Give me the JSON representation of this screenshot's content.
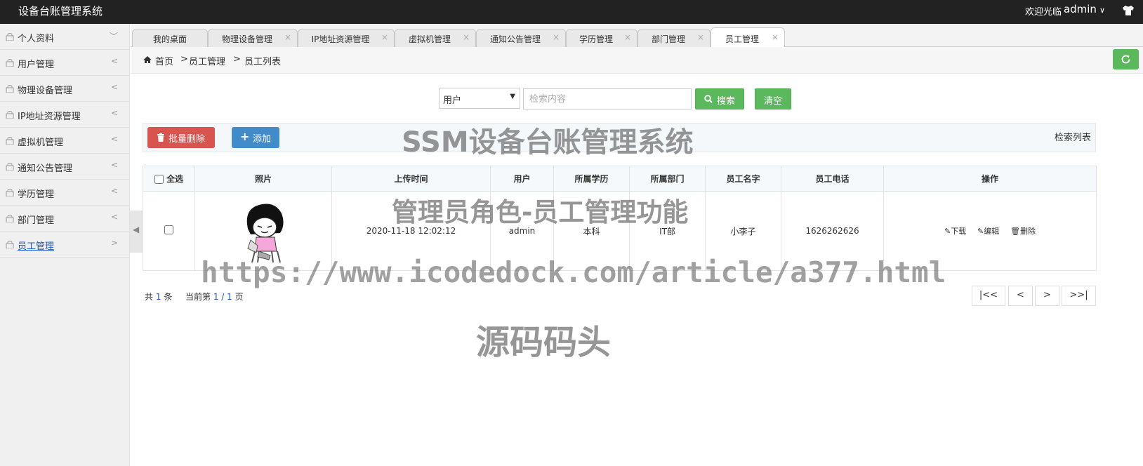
{
  "app": {
    "title": "设备台账管理系统",
    "welcome": "欢迎光临",
    "username": "admin"
  },
  "sidebar": {
    "items": [
      {
        "label": "个人资料",
        "arrow": "﹀"
      },
      {
        "label": "用户管理",
        "arrow": "<"
      },
      {
        "label": "物理设备管理",
        "arrow": "<"
      },
      {
        "label": "IP地址资源管理",
        "arrow": "<"
      },
      {
        "label": "虚拟机管理",
        "arrow": "<"
      },
      {
        "label": "通知公告管理",
        "arrow": "<"
      },
      {
        "label": "学历管理",
        "arrow": "<"
      },
      {
        "label": "部门管理",
        "arrow": "<"
      },
      {
        "label": "员工管理",
        "arrow": ">"
      }
    ]
  },
  "tabs": [
    {
      "label": "我的桌面"
    },
    {
      "label": "物理设备管理"
    },
    {
      "label": "IP地址资源管理"
    },
    {
      "label": "虚拟机管理"
    },
    {
      "label": "通知公告管理"
    },
    {
      "label": "学历管理"
    },
    {
      "label": "部门管理"
    },
    {
      "label": "员工管理"
    }
  ],
  "tab_close": "×",
  "breadcrumb": {
    "home": "首页",
    "level1": "员工管理",
    "level2": "员工列表",
    "sep": ">"
  },
  "search": {
    "field_selected": "用户",
    "placeholder": "检索内容",
    "value": "",
    "search_label": "搜索",
    "clear_label": "清空"
  },
  "toolbar": {
    "batch_delete_label": "批量删除",
    "add_label": "添加",
    "list_title": "检索列表"
  },
  "table": {
    "headers": {
      "select_all": "全选",
      "photo": "照片",
      "upload_time": "上传时间",
      "user": "用户",
      "education": "所属学历",
      "department": "所属部门",
      "name": "员工名字",
      "phone": "员工电话",
      "ops": "操作"
    },
    "rows": [
      {
        "upload_time": "2020-11-18 12:02:12",
        "user": "admin",
        "education": "本科",
        "department": "IT部",
        "name": "小李子",
        "phone": "1626262626",
        "op_download": "下载",
        "op_edit": "编辑",
        "op_delete": "删除"
      }
    ]
  },
  "pagination": {
    "total_prefix": "共",
    "total": "1",
    "total_suffix": "条",
    "current_prefix": "当前第",
    "current": "1 / 1",
    "current_suffix": "页",
    "first": "|<<",
    "prev": "<",
    "next": ">",
    "last": ">>|"
  },
  "watermark": {
    "line1": "SSM设备台账管理系统",
    "line2": "管理员角色-员工管理功能",
    "line3": "https://www.icodedock.com/article/a377.html",
    "line4": "源码码头"
  },
  "colors": {
    "topbar": "#222222",
    "green": "#5cb85c",
    "red": "#d9534f",
    "blue": "#428bca",
    "link": "#1a56c9"
  }
}
